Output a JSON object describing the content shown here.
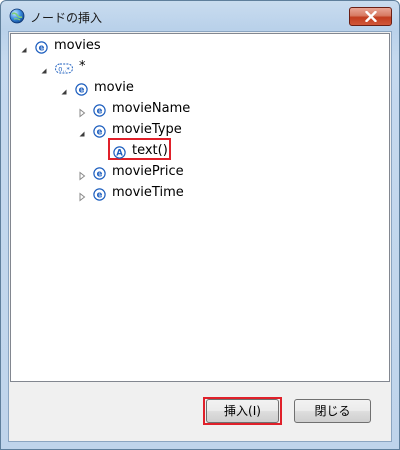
{
  "window": {
    "title": "ノードの挿入"
  },
  "tree": {
    "nodes": [
      {
        "label": "movies",
        "icon": "element-icon",
        "expander": "expanded"
      },
      {
        "label": "*",
        "icon": "wildcard-icon",
        "expander": "expanded"
      },
      {
        "label": "movie",
        "icon": "element-icon",
        "expander": "expanded"
      },
      {
        "label": "movieName",
        "icon": "element-icon",
        "expander": "collapsed"
      },
      {
        "label": "movieType",
        "icon": "element-icon",
        "expander": "expanded"
      },
      {
        "label": "text()",
        "icon": "attribute-icon",
        "expander": "none",
        "selected": true
      },
      {
        "label": "moviePrice",
        "icon": "element-icon",
        "expander": "collapsed"
      },
      {
        "label": "movieTime",
        "icon": "element-icon",
        "expander": "collapsed"
      }
    ],
    "element_glyph": "e",
    "attribute_glyph": "A",
    "wildcard_glyph": "0..*"
  },
  "buttons": {
    "insert_label": "挿入(I)",
    "close_label": "閉じる"
  },
  "colors": {
    "highlight": "#e0202a",
    "element_icon": "#1e5fbf"
  }
}
